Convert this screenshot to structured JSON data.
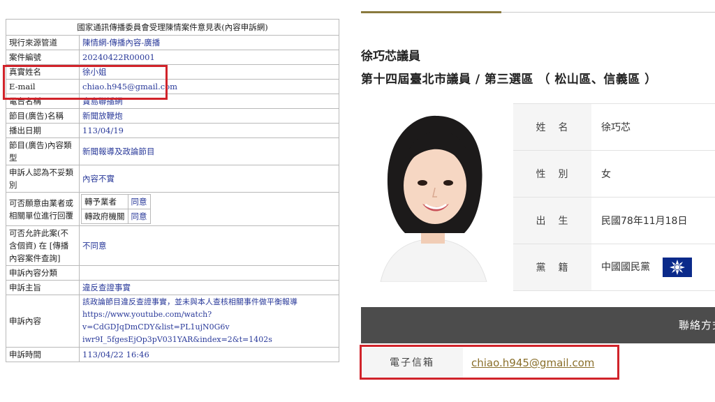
{
  "form": {
    "title": "國家通訊傳播委員會受理陳情案件意見表(內容申訴網)",
    "rows": [
      {
        "label": "現行來源管道",
        "value": "陳情網-傳播內容-廣播"
      },
      {
        "label": "案件編號",
        "value": "20240422R00001"
      },
      {
        "label": "真實姓名",
        "value": "徐小姐"
      },
      {
        "label": "E-mail",
        "value": "chiao.h945@gmail.com"
      },
      {
        "label": "電台名稱",
        "value": "寶島聯播網"
      },
      {
        "label": "節目(廣告)名稱",
        "value": "新聞放鞭炮"
      },
      {
        "label": "播出日期",
        "value": "113/04/19"
      },
      {
        "label": "節目(廣告)內容類型",
        "value": "新聞報導及政論節目"
      },
      {
        "label": "申訴人認為不妥類別",
        "value": "內容不實"
      },
      {
        "label": "可否願意由業者或相關單位進行回覆",
        "sub": [
          {
            "label": "轉予業者",
            "value": "同意"
          },
          {
            "label": "轉政府機關",
            "value": "同意"
          }
        ]
      },
      {
        "label": "可否允許此案(不含個資) 在 [傳播內容案件查詢]",
        "value": "不同意"
      },
      {
        "label": "申訴內容分類",
        "value": ""
      },
      {
        "label": "申訴主旨",
        "value": "違反查證事實"
      },
      {
        "label": "申訴內容",
        "value_line1": "該政論節目違反查證事實，並未與本人查核相關事件做平衡報導",
        "value_line2": "https://www.youtube.com/watch?v=CdGDJqDmCDY&list=PL1ujN0G6v",
        "value_line3": "iwr9I_5fgesEjOp3pV031YAR&index=2&t=1402s"
      },
      {
        "label": "申訴時間",
        "value": "113/04/22 16:46"
      }
    ]
  },
  "profile": {
    "name_title": "徐巧芯議員",
    "term_title": "第十四屆臺北市議員 / 第三選區 （ 松山區、信義區 ）",
    "fields": [
      {
        "label": "姓名",
        "value": "徐巧芯"
      },
      {
        "label": "性別",
        "value": "女"
      },
      {
        "label": "出生",
        "value": "民國78年11月18日"
      },
      {
        "label": "黨籍",
        "value": "中國國民黨"
      }
    ],
    "contact_header": "聯絡方式",
    "email_label": "電子信箱",
    "email_value": "chiao.h945@gmail.com"
  },
  "colors": {
    "highlight": "#d1232a",
    "form_link": "#2a3a9a",
    "gold_accent": "#8a7a3e",
    "email_link": "#8a6f2b",
    "contact_bar": "#4c4c4c",
    "flag_blue": "#0b2a8a"
  },
  "icons": {
    "party_flag": "taiwan-flag-icon",
    "portrait": "councillor-photo"
  }
}
